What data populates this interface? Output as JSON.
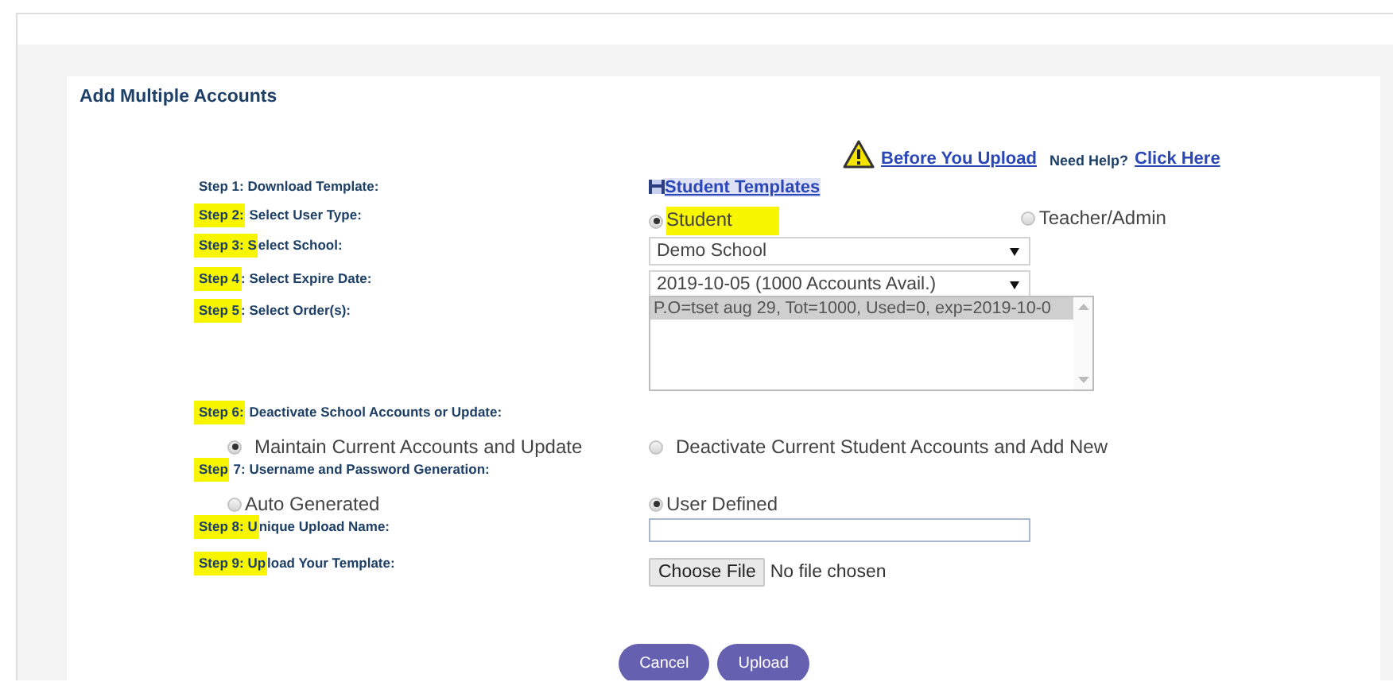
{
  "title": "Add Multiple Accounts",
  "help": {
    "link": "Before You Upload",
    "prompt": "Need Help?",
    "help_link": "Click Here"
  },
  "steps": [
    {
      "label": "Step 1: Download Template:",
      "kind": "link",
      "link": "Student Templates"
    },
    {
      "marked": "Step 2:",
      "label": " Select User Type:",
      "kind": "radio",
      "options": [
        {
          "label": "Student",
          "selected": true,
          "marked": true
        },
        {
          "label": "Teacher/Admin",
          "selected": false,
          "marked": false
        }
      ]
    },
    {
      "marked": "Step 3: S",
      "label": "elect School:",
      "kind": "select",
      "value": "Demo School"
    },
    {
      "marked": "Step 4",
      "label": ": Select Expire Date:",
      "kind": "select",
      "value": "2019-10-05 (1000 Accounts Avail.)"
    },
    {
      "marked": "Step 5",
      "label": ": Select Order(s):",
      "kind": "listbox",
      "items": [
        {
          "text": "P.O=tset aug 29, Tot=1000, Used=0, exp=2019-10-0",
          "selected": true
        }
      ]
    },
    {
      "marked": "Step 6:",
      "label": " Deactivate School Accounts or Update:",
      "kind": "radio-below",
      "options": [
        {
          "label": "Maintain Current Accounts and Update",
          "selected": true
        },
        {
          "label": "Deactivate Current Student Accounts and Add New",
          "selected": false
        }
      ]
    },
    {
      "marked": "Step",
      "label": " 7: Username and Password Generation:",
      "kind": "radio-below",
      "options": [
        {
          "label": "Auto Generated",
          "selected": false
        },
        {
          "label": "User Defined",
          "selected": true
        }
      ]
    },
    {
      "marked": "Step 8: U",
      "label": "nique Upload Name:",
      "kind": "text"
    },
    {
      "marked": "Step 9: Up",
      "label": "load Your Template:",
      "kind": "file",
      "button": "Choose File",
      "status": "No file chosen"
    }
  ],
  "buttons": [
    {
      "label": "Cancel"
    },
    {
      "label": "Upload"
    }
  ]
}
